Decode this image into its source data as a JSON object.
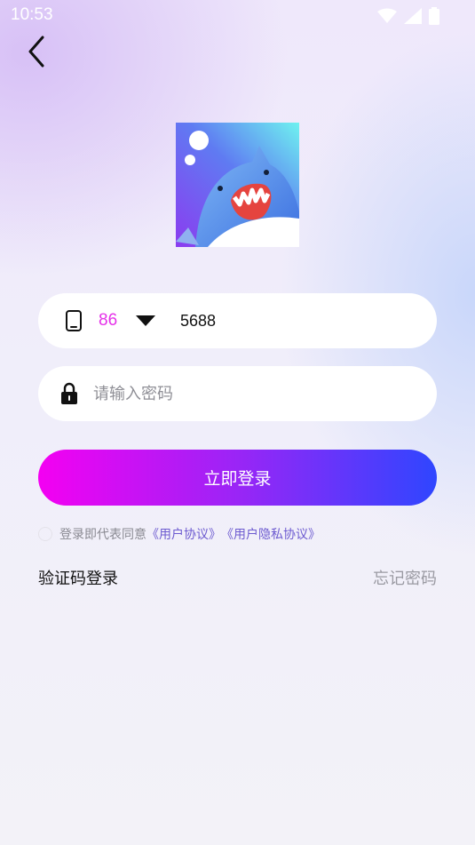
{
  "status_bar": {
    "time": "10:53",
    "icons": [
      "wifi-icon",
      "signal-icon",
      "battery-icon"
    ]
  },
  "header": {
    "back_icon": "chevron-left-icon"
  },
  "logo": {
    "icon": "shark-logo-icon"
  },
  "phone_field": {
    "icon": "phone-icon",
    "country_code": "86",
    "dropdown_icon": "caret-down-icon",
    "value": "5688"
  },
  "password_field": {
    "icon": "lock-icon",
    "placeholder": "请输入密码",
    "value": ""
  },
  "login_button": {
    "label": "立即登录"
  },
  "agreement": {
    "text": "登录即代表同意",
    "user_agreement": "《用户协议》",
    "privacy_agreement": "《用户隐私协议》"
  },
  "footer_links": {
    "sms_login": "验证码登录",
    "forgot_password": "忘记密码"
  },
  "colors": {
    "accent_pink": "#e531e9",
    "gradient_start": "#f400f2",
    "gradient_end": "#2f46ff",
    "link": "#6d5bd0"
  }
}
